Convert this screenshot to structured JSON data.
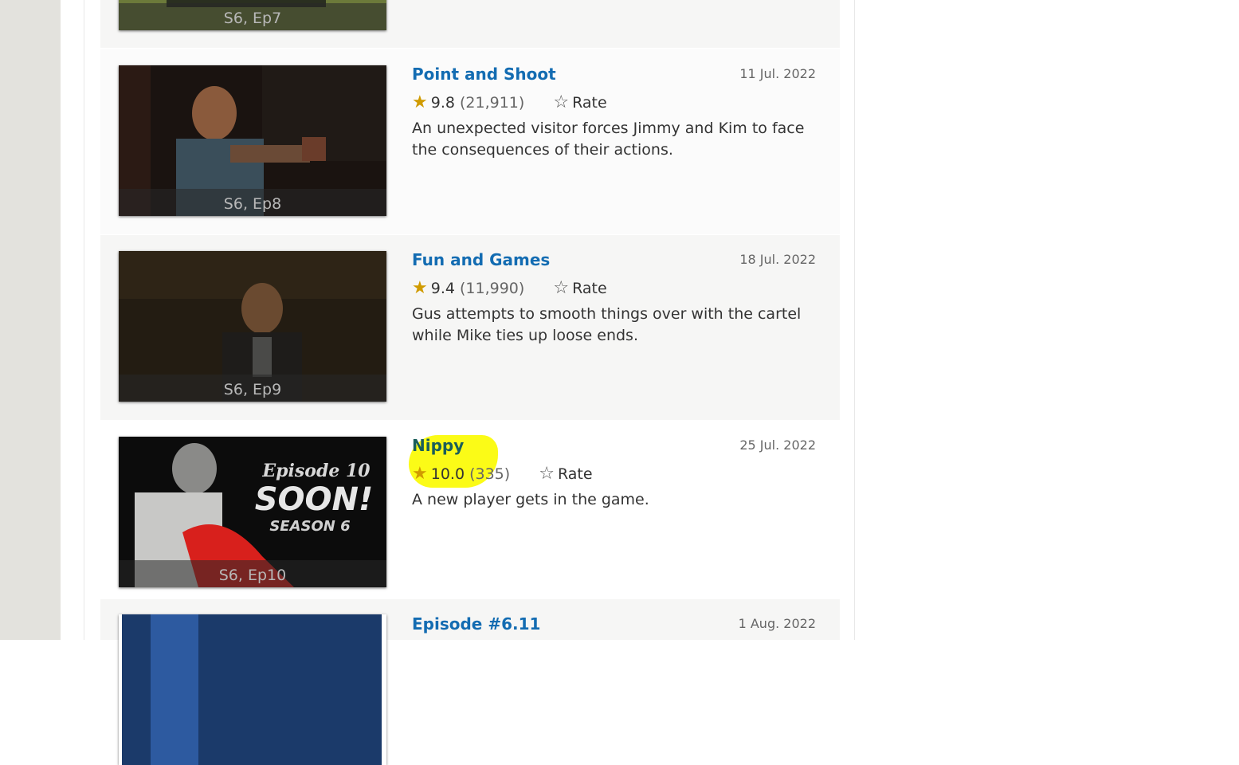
{
  "episodes": [
    {
      "label": "S6, Ep7"
    },
    {
      "title": "Point and Shoot",
      "airdate": "11 Jul. 2022",
      "rating": "9.8",
      "votes": "(21,911)",
      "rate_label": "Rate",
      "desc": "An unexpected visitor forces Jimmy and Kim to face the consequences of their actions.",
      "label": "S6, Ep8"
    },
    {
      "title": "Fun and Games",
      "airdate": "18 Jul. 2022",
      "rating": "9.4",
      "votes": "(11,990)",
      "rate_label": "Rate",
      "desc": "Gus attempts to smooth things over with the cartel while Mike ties up loose ends.",
      "label": "S6, Ep9"
    },
    {
      "title": "Nippy",
      "airdate": "25 Jul. 2022",
      "rating": "10.0",
      "votes": "(335)",
      "rate_label": "Rate",
      "desc": "A new player gets in the game.",
      "label": "S6, Ep10",
      "poster_text": {
        "line1": "Episode 10",
        "line2": "SOON!",
        "line3": "SEASON 6"
      }
    },
    {
      "title": "Episode #6.11",
      "airdate": "1 Aug. 2022"
    }
  ],
  "icons": {
    "filled_star": "star-filled-icon",
    "outline_star": "star-outline-icon"
  },
  "colors": {
    "title_link": "#136cb2",
    "star": "#d09b00",
    "highlight": "#fbfb12"
  }
}
